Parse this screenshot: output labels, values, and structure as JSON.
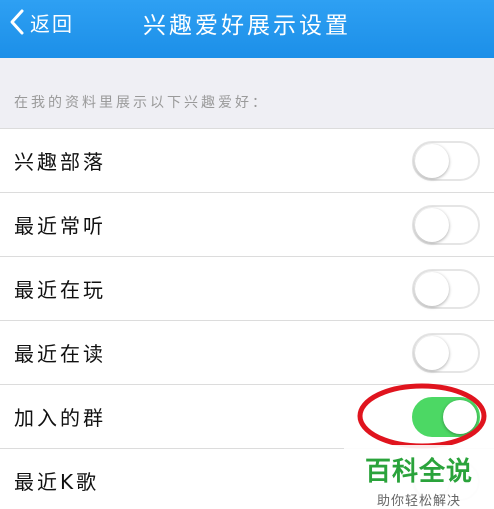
{
  "navbar": {
    "back_label": "返回",
    "title": "兴趣爱好展示设置"
  },
  "section": {
    "header": "在我的资料里展示以下兴趣爱好："
  },
  "settings": [
    {
      "label": "兴趣部落",
      "enabled": false
    },
    {
      "label": "最近常听",
      "enabled": false
    },
    {
      "label": "最近在玩",
      "enabled": false
    },
    {
      "label": "最近在读",
      "enabled": false
    },
    {
      "label": "加入的群",
      "enabled": true
    },
    {
      "label": "最近K歌",
      "enabled": false
    }
  ],
  "watermark": {
    "logo": "百科全说",
    "tagline": "助你轻松解决"
  },
  "colors": {
    "navbar": "#1c8fe8",
    "toggle_on": "#4cd864",
    "annotation_ring": "#e0141e",
    "watermark_green": "#2aa33b"
  }
}
